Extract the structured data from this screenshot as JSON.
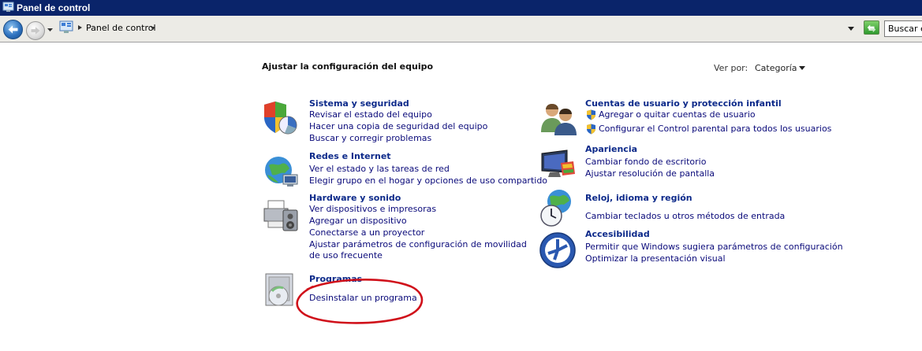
{
  "window": {
    "title": "Panel de control"
  },
  "address_bar": {
    "location": "Panel de control",
    "search_placeholder": "Buscar en el Panel de control"
  },
  "header": {
    "heading": "Ajustar la configuración del equipo",
    "view_by_label": "Ver por:",
    "view_by_value": "Categoría"
  },
  "categories": [
    {
      "title": "Sistema y seguridad",
      "icon": "shield-chart-icon",
      "links": [
        "Revisar el estado del equipo",
        "Hacer una copia de seguridad del equipo",
        "Buscar y corregir problemas"
      ]
    },
    {
      "title": "Redes e Internet",
      "icon": "globe-network-icon",
      "links": [
        "Ver el estado y las tareas de red",
        "Elegir grupo en el hogar y opciones de uso compartido"
      ]
    },
    {
      "title": "Hardware y sonido",
      "icon": "printer-speaker-icon",
      "links": [
        "Ver dispositivos e impresoras",
        "Agregar un dispositivo",
        "Conectarse a un proyector",
        "Ajustar parámetros de configuración de movilidad de uso frecuente"
      ]
    },
    {
      "title": "Programas",
      "icon": "programs-disc-icon",
      "links": [
        "Desinstalar un programa"
      ]
    },
    {
      "title": "Cuentas de usuario y protección infantil",
      "icon": "users-icon",
      "links": [
        "Agregar o quitar cuentas de usuario",
        "Configurar el Control parental para todos los usuarios"
      ]
    },
    {
      "title": "Apariencia",
      "icon": "monitor-palette-icon",
      "links": [
        "Cambiar fondo de escritorio",
        "Ajustar resolución de pantalla"
      ]
    },
    {
      "title": "Reloj, idioma y región",
      "icon": "globe-clock-icon",
      "links": [
        "Cambiar teclados u otros métodos de entrada"
      ]
    },
    {
      "title": "Accesibilidad",
      "icon": "accessibility-icon",
      "links": [
        "Permitir que Windows sugiera parámetros de configuración",
        "Optimizar la presentación visual"
      ]
    }
  ],
  "colors": {
    "title_bar": "#0a246a",
    "category_title": "#0d2a8a",
    "link": "#0a0a7a",
    "annotation": "#d0101a"
  }
}
